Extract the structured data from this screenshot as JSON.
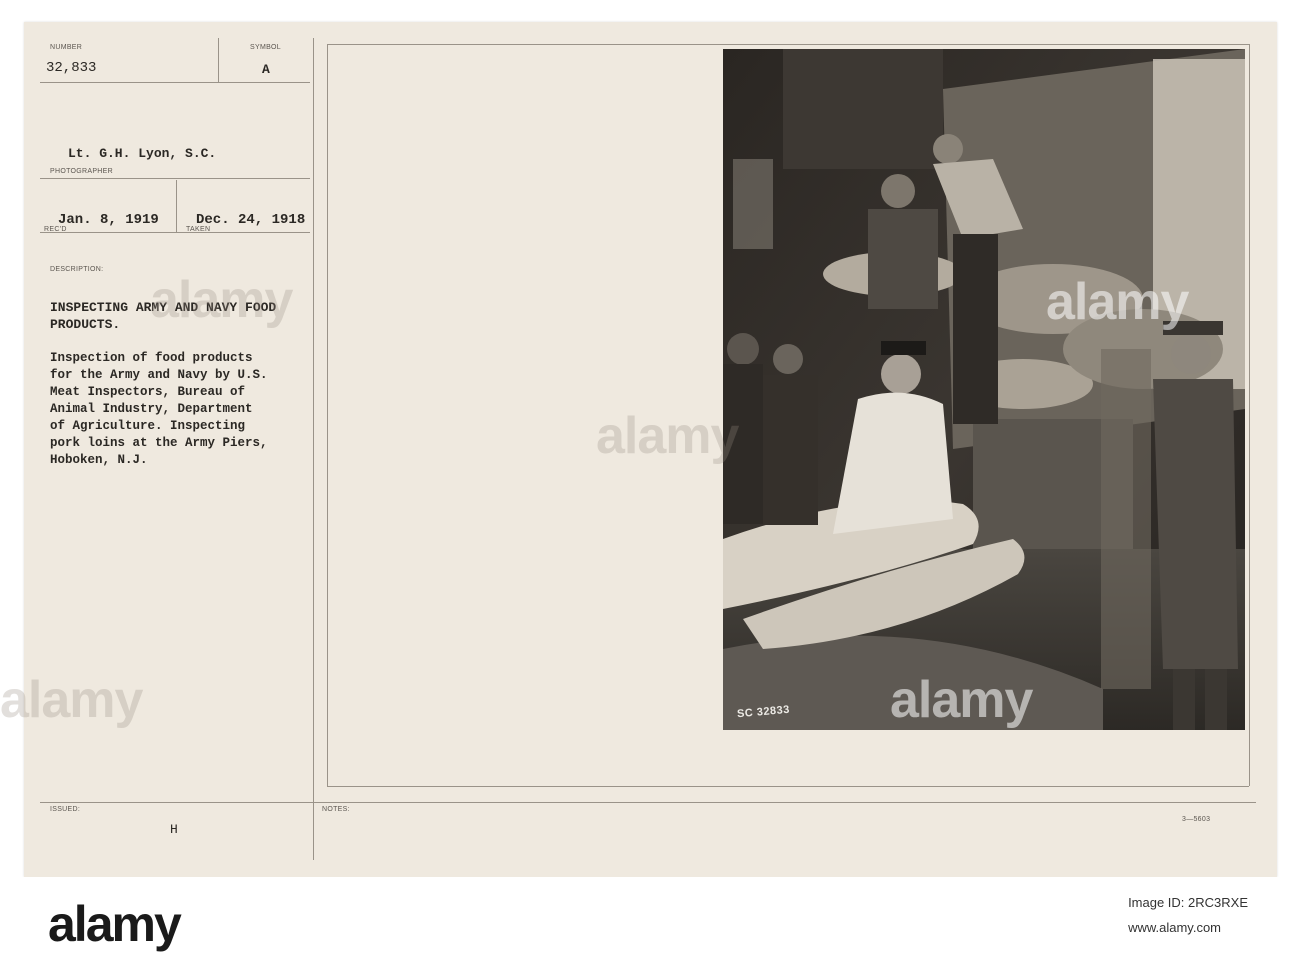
{
  "card": {
    "number_label": "NUMBER",
    "number_value": "32,833",
    "symbol_label": "SYMBOL",
    "symbol_value": "A",
    "photographer_name": "Lt. G.H. Lyon, S.C.",
    "photographer_label": "PHOTOGRAPHER",
    "recd_date": "Jan. 8, 1919",
    "recd_label": "REC'D",
    "taken_date": "Dec. 24, 1918",
    "taken_label": "TAKEN",
    "description_label": "DESCRIPTION:",
    "title_line1": "INSPECTING ARMY AND NAVY FOOD",
    "title_line2": "PRODUCTS.",
    "body_lines": [
      "Inspection of food products",
      "for the Army and Navy by U.S.",
      "Meat Inspectors, Bureau of",
      "Animal Industry, Department",
      "of Agriculture.  Inspecting",
      "pork loins at the Army Piers,",
      "Hoboken, N.J."
    ],
    "issued_label": "ISSUED:",
    "issued_value": "H",
    "notes_label": "NOTES:",
    "form_number": "3—5603",
    "negative_number": "SC 32833"
  },
  "watermark": {
    "text": "alamy"
  },
  "footer": {
    "logo_text": "alamy",
    "image_id": "Image ID: 2RC3RXE",
    "url": "www.alamy.com"
  }
}
